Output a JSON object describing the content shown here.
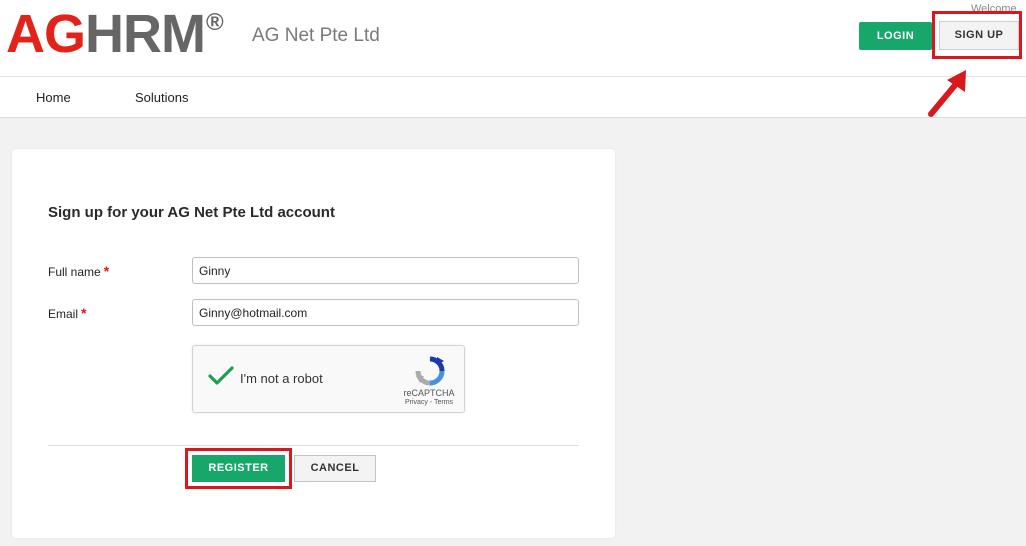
{
  "header": {
    "logo_ag": "AG",
    "logo_hrm": "HRM",
    "logo_reg": "®",
    "company_name": "AG Net Pte Ltd",
    "welcome": "Welcome",
    "login_label": "LOGIN",
    "signup_label": "SIGN UP"
  },
  "nav": {
    "items": [
      {
        "label": "Home"
      },
      {
        "label": "Solutions"
      }
    ]
  },
  "form": {
    "title": "Sign up for your AG Net Pte Ltd account",
    "fullname_label": "Full name",
    "fullname_value": "Ginny",
    "email_label": "Email",
    "email_value": "Ginny@hotmail.com",
    "required_marker": "*",
    "captcha": {
      "text": "I'm not a robot",
      "brand": "reCAPTCHA",
      "links": "Privacy - Terms",
      "checked": true
    },
    "register_label": "REGISTER",
    "cancel_label": "CANCEL"
  },
  "colors": {
    "brand_red": "#e2231a",
    "brand_grey": "#666666",
    "accent_green": "#17a76b",
    "highlight_red": "#d8181c",
    "page_bg": "#f2f2f2"
  }
}
